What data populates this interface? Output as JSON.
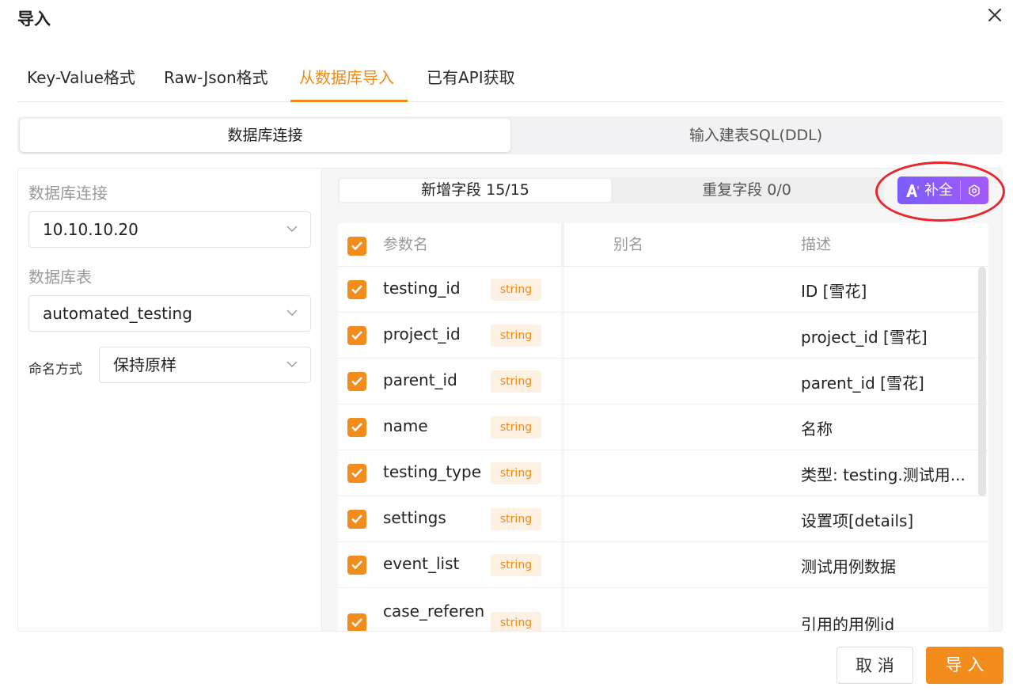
{
  "dialog": {
    "title": "导入"
  },
  "tabs": [
    {
      "label": "Key-Value格式",
      "active": false
    },
    {
      "label": "Raw-Json格式",
      "active": false
    },
    {
      "label": "从数据库导入",
      "active": true
    },
    {
      "label": "已有API获取",
      "active": false
    }
  ],
  "mode_switch": {
    "active": "数据库连接",
    "inactive": "输入建表SQL(DDL)"
  },
  "left_panel": {
    "db_conn_label": "数据库连接",
    "db_conn_value": "10.10.10.20",
    "db_table_label": "数据库表",
    "db_table_value": "automated_testing",
    "naming_label": "命名方式",
    "naming_value": "保持原样"
  },
  "fields_switch": {
    "new_fields": "新增字段 15/15",
    "dup_fields": "重复字段 0/0"
  },
  "ai_button": {
    "label": "补全",
    "icon": "ai-logo-icon",
    "settings_icon": "settings-hex-icon"
  },
  "table": {
    "headers": {
      "name": "参数名",
      "alias": "别名",
      "desc": "描述"
    },
    "rows": [
      {
        "name": "testing_id",
        "type": "string",
        "desc": "ID [雪花]"
      },
      {
        "name": "project_id",
        "type": "string",
        "desc": "project_id [雪花]"
      },
      {
        "name": "parent_id",
        "type": "string",
        "desc": "parent_id [雪花]"
      },
      {
        "name": "name",
        "type": "string",
        "desc": "名称"
      },
      {
        "name": "testing_type",
        "type": "string",
        "desc": "类型: testing.测试用..."
      },
      {
        "name": "settings",
        "type": "string",
        "desc": "设置项[details]"
      },
      {
        "name": "event_list",
        "type": "string",
        "desc": "测试用例数据"
      },
      {
        "name": "case_referen",
        "type": "string",
        "desc": "引用的用例id"
      }
    ]
  },
  "footer": {
    "cancel": "取 消",
    "import": "导 入"
  },
  "colors": {
    "accent": "#f08a17",
    "ai_gradient_start": "#7b5cff",
    "ai_gradient_end": "#a45af7",
    "highlight": "#e8262b"
  }
}
